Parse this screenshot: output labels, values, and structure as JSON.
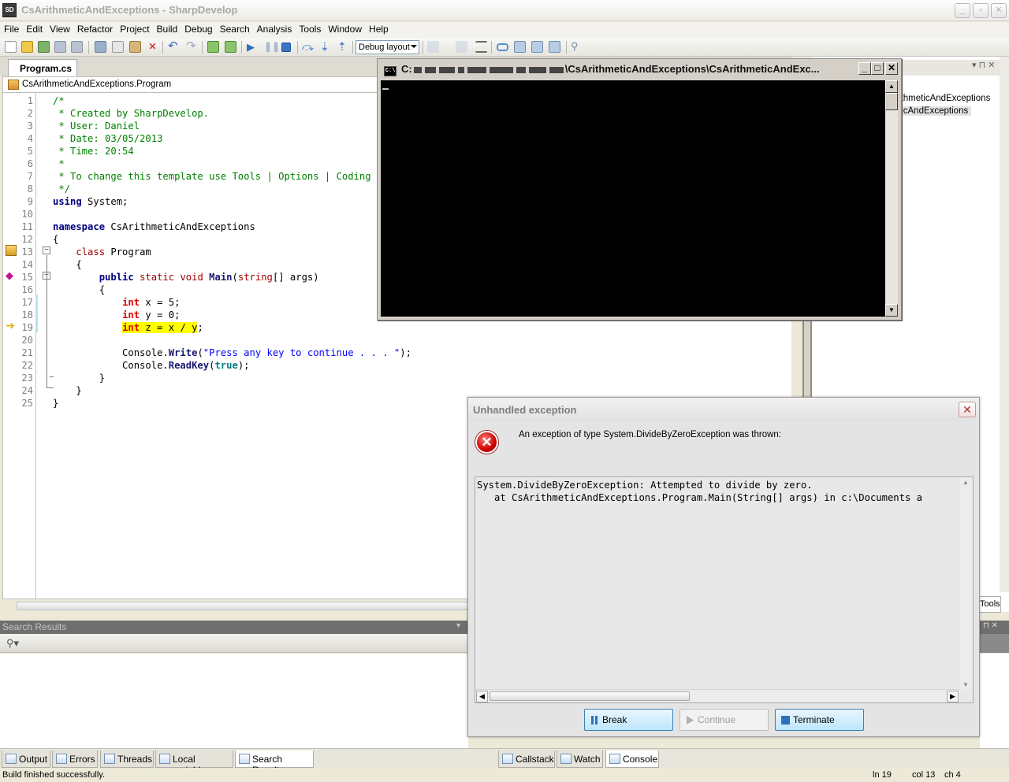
{
  "window": {
    "title": "CsArithmeticAndExceptions - SharpDevelop",
    "app_icon": "SD"
  },
  "menu": [
    "File",
    "Edit",
    "View",
    "Refactor",
    "Project",
    "Build",
    "Debug",
    "Search",
    "Analysis",
    "Tools",
    "Window",
    "Help"
  ],
  "toolbar": {
    "layout_value": "Debug layout"
  },
  "editor": {
    "tab_label": "Program.cs",
    "class_combo": "CsArithmeticAndExceptions.Program",
    "current_line": 19
  },
  "right_panel": {
    "items": [
      "ithmeticAndExceptions",
      "ticAndExceptions"
    ]
  },
  "search_results": {
    "header": "Search Results"
  },
  "right_tools_tab": "Tools",
  "bottom_tabs_left": [
    "Output",
    "Errors",
    "Threads",
    "Local variables",
    "Search Results"
  ],
  "bottom_tabs_right": [
    "Callstack",
    "Watch",
    "Console"
  ],
  "status": {
    "message": "Build finished successfully.",
    "line": "ln 19",
    "col": "col 13",
    "ch": "ch 4"
  },
  "console": {
    "title_prefix": "C:",
    "title_suffix": "\\CsArithmeticAndExceptions\\CsArithmeticAndExc...",
    "icon_text": "C:\\"
  },
  "dialog": {
    "title": "Unhandled exception",
    "message": "An exception of type System.DivideByZeroException was thrown:",
    "trace": [
      "System.DivideByZeroException: Attempted to divide by zero.",
      "   at CsArithmeticAndExceptions.Program.Main(String[] args) in c:\\Documents a"
    ],
    "buttons": {
      "break": "Break",
      "continue": "Continue",
      "terminate": "Terminate"
    }
  },
  "colors": {
    "highlight": "#ffff00",
    "comment": "#008000",
    "keyword": "#000080",
    "string": "#0000ff"
  }
}
